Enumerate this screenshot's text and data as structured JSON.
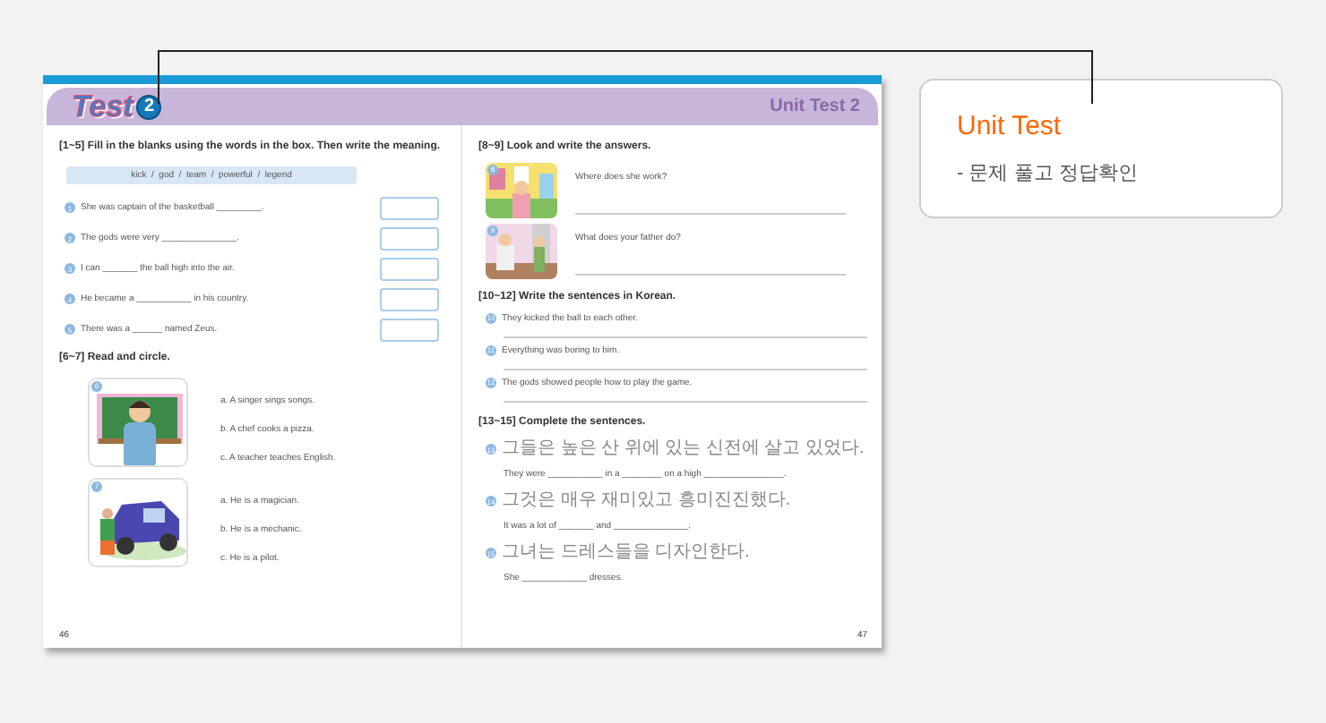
{
  "book": {
    "badge_word": "Test",
    "badge_number": "2",
    "unit_title": "Unit Test 2",
    "left_page": {
      "number": "46",
      "fill_in": {
        "heading": "[1~5] Fill in the blanks using the words in the box. Then write the meaning.",
        "word_box": "kick  /  god  /  team  /  powerful  /  legend",
        "items": [
          {
            "number": "1",
            "sentence": "She was captain of the basketball _________."
          },
          {
            "number": "2",
            "sentence": "The gods were very _______________."
          },
          {
            "number": "3",
            "sentence": "I can _______ the ball high into the air."
          },
          {
            "number": "4",
            "sentence": "He became a ___________ in his country."
          },
          {
            "number": "5",
            "sentence": "There was a ______ named Zeus."
          }
        ]
      },
      "circle": {
        "heading": "[6~7] Read and circle.",
        "items": [
          {
            "number": "6",
            "options": [
              "a. A singer sings songs.",
              "b. A chef cooks a pizza.",
              "c. A teacher teaches English."
            ]
          },
          {
            "number": "7",
            "options": [
              "a. He is a magician.",
              "b. He is a mechanic.",
              "c. He is a pilot."
            ]
          }
        ]
      }
    },
    "right_page": {
      "number": "47",
      "look": {
        "heading": "[8~9] Look and write the answers.",
        "items": [
          {
            "number": "8",
            "question": "Where does she work?"
          },
          {
            "number": "9",
            "question": "What does your father do?"
          }
        ]
      },
      "korean": {
        "heading": "[10~12] Write the sentences in Korean.",
        "items": [
          {
            "number": "10",
            "sentence": "They kicked the ball to each other."
          },
          {
            "number": "11",
            "sentence": "Everything was boring to him."
          },
          {
            "number": "12",
            "sentence": "The gods showed people how to play the game."
          }
        ]
      },
      "complete": {
        "heading": "[13~15] Complete the sentences.",
        "items": [
          {
            "number": "13",
            "korean": "그들은 높은 산 위에 있는 신전에 살고 있었다.",
            "english": "They were ___________ in a ________ on a high ________________."
          },
          {
            "number": "14",
            "korean": "그것은 매우 재미있고 흥미진진했다.",
            "english": "It was a lot of _______ and _______________."
          },
          {
            "number": "15",
            "korean": "그녀는 드레스들을 디자인한다.",
            "english": "She _____________ dresses."
          }
        ]
      }
    }
  },
  "callout": {
    "title": "Unit Test",
    "subtitle": "- 문제 풀고 정답확인"
  }
}
